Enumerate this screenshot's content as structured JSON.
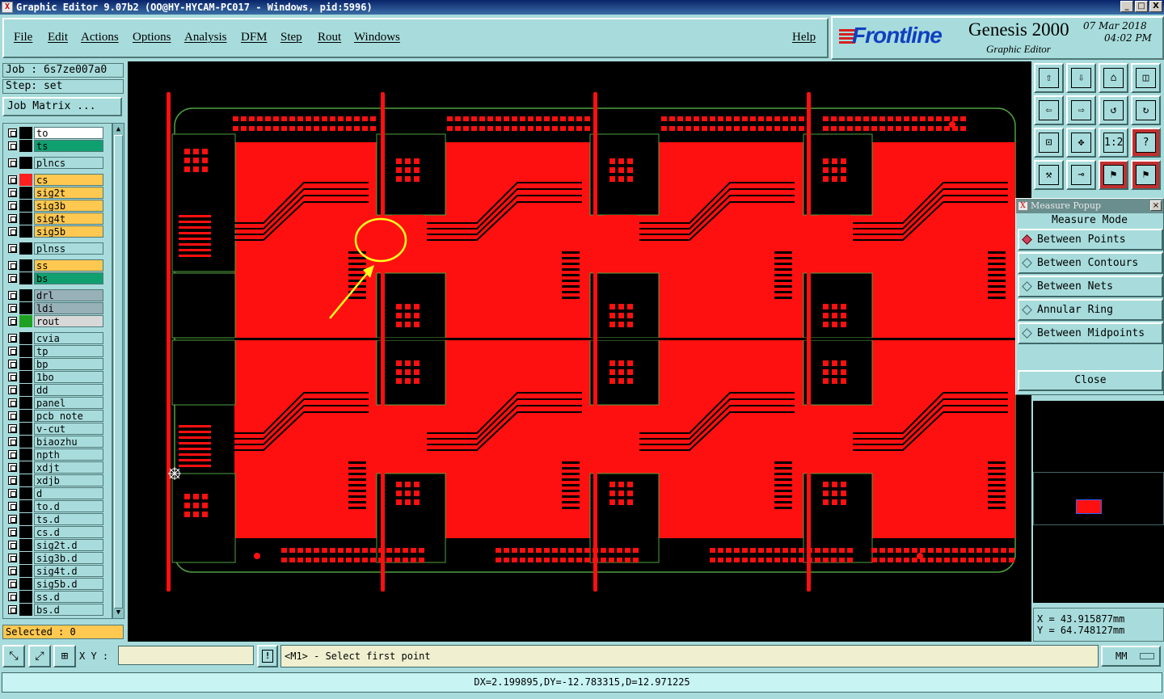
{
  "window": {
    "title": "Graphic Editor 9.07b2 (OO@HY-HYCAM-PC017 - Windows, pid:5996)",
    "buttons": [
      "_",
      "□",
      "X"
    ]
  },
  "menu": {
    "items": [
      "File",
      "Edit",
      "Actions",
      "Options",
      "Analysis",
      "DFM",
      "Step",
      "Rout",
      "Windows"
    ],
    "help": "Help"
  },
  "brand": {
    "logo": "Frontline",
    "product": "Genesis 2000",
    "subtitle": "Graphic Editor",
    "date": "07 Mar 2018",
    "time": "04:02 PM"
  },
  "job": {
    "job_label": "Job : 6s7ze007a0",
    "step_label": "Step: set",
    "matrix_button": "Job Matrix ..."
  },
  "layers": [
    {
      "name": "to",
      "color": "#ffffff",
      "swatch": "#000000"
    },
    {
      "name": "ts",
      "color": "#10a070",
      "swatch": "#000000"
    },
    {
      "name": "plncs",
      "color": "#a8dcdc",
      "swatch": "#000000"
    },
    {
      "name": "cs",
      "color": "#ffc850",
      "swatch": "#ff2020"
    },
    {
      "name": "sig2t",
      "color": "#ffc850",
      "swatch": "#000000"
    },
    {
      "name": "sig3b",
      "color": "#ffc850",
      "swatch": "#000000"
    },
    {
      "name": "sig4t",
      "color": "#ffc850",
      "swatch": "#000000"
    },
    {
      "name": "sig5b",
      "color": "#ffc850",
      "swatch": "#000000"
    },
    {
      "name": "plnss",
      "color": "#a8dcdc",
      "swatch": "#000000"
    },
    {
      "name": "ss",
      "color": "#ffc850",
      "swatch": "#000000"
    },
    {
      "name": "bs",
      "color": "#10a070",
      "swatch": "#000000"
    },
    {
      "name": "drl",
      "color": "#98b0b8",
      "swatch": "#000000"
    },
    {
      "name": "ldi",
      "color": "#98b0b8",
      "swatch": "#000000"
    },
    {
      "name": "rout",
      "color": "#d8d8d8",
      "swatch": "#20a020"
    },
    {
      "name": "cvia",
      "color": "#a8dcdc",
      "swatch": "#000000"
    },
    {
      "name": "tp",
      "color": "#a8dcdc",
      "swatch": "#000000"
    },
    {
      "name": "bp",
      "color": "#a8dcdc",
      "swatch": "#000000"
    },
    {
      "name": "1bo",
      "color": "#a8dcdc",
      "swatch": "#000000"
    },
    {
      "name": "dd",
      "color": "#a8dcdc",
      "swatch": "#000000"
    },
    {
      "name": "panel",
      "color": "#a8dcdc",
      "swatch": "#000000"
    },
    {
      "name": "pcb_note",
      "color": "#a8dcdc",
      "swatch": "#000000"
    },
    {
      "name": "v-cut",
      "color": "#a8dcdc",
      "swatch": "#000000"
    },
    {
      "name": "biaozhu",
      "color": "#a8dcdc",
      "swatch": "#000000"
    },
    {
      "name": "npth",
      "color": "#a8dcdc",
      "swatch": "#000000"
    },
    {
      "name": "xdjt",
      "color": "#a8dcdc",
      "swatch": "#000000"
    },
    {
      "name": "xdjb",
      "color": "#a8dcdc",
      "swatch": "#000000"
    },
    {
      "name": "d",
      "color": "#a8dcdc",
      "swatch": "#000000"
    },
    {
      "name": "to.d",
      "color": "#a8dcdc",
      "swatch": "#000000"
    },
    {
      "name": "ts.d",
      "color": "#a8dcdc",
      "swatch": "#000000"
    },
    {
      "name": "cs.d",
      "color": "#a8dcdc",
      "swatch": "#000000"
    },
    {
      "name": "sig2t.d",
      "color": "#a8dcdc",
      "swatch": "#000000"
    },
    {
      "name": "sig3b.d",
      "color": "#a8dcdc",
      "swatch": "#000000"
    },
    {
      "name": "sig4t.d",
      "color": "#a8dcdc",
      "swatch": "#000000"
    },
    {
      "name": "sig5b.d",
      "color": "#a8dcdc",
      "swatch": "#000000"
    },
    {
      "name": "ss.d",
      "color": "#a8dcdc",
      "swatch": "#000000"
    },
    {
      "name": "bs.d",
      "color": "#a8dcdc",
      "swatch": "#000000"
    }
  ],
  "selected": "Selected : 0",
  "measure_popup": {
    "title": "Measure Popup",
    "mode_label": "Measure Mode",
    "options": [
      "Between Points",
      "Between Contours",
      "Between Nets",
      "Annular Ring",
      "Between Midpoints"
    ],
    "selected_option": "Between Points",
    "close": "Close"
  },
  "toolbar_icons": [
    "zoom-home-icon",
    "zoom-home-icon",
    "home-icon",
    "window-icon",
    "pan-left-icon",
    "pan-right-icon",
    "undo-zoom-icon",
    "redraw-icon",
    "fit-icon",
    "center-icon",
    "scale-icon",
    "help-icon",
    "tools-icon",
    "snap-icon",
    "traffic-light-icon",
    "traffic-light-icon"
  ],
  "toolbar_text": {
    "scale": "1:2",
    "help": "?"
  },
  "coords": {
    "x": "X = 43.915877mm",
    "y": "Y = 64.748127mm"
  },
  "bottom": {
    "xy_label": "X Y :",
    "xy_value": "",
    "excl": "!",
    "prompt": "<M1> - Select first point",
    "units": "MM"
  },
  "status": "DX=2.199895,DY=-12.783315,D=12.971225",
  "colors": {
    "background": "#a8dcdc",
    "board_fill": "#ff1010",
    "outline": "#50a040",
    "annotation": "#ffff20"
  }
}
